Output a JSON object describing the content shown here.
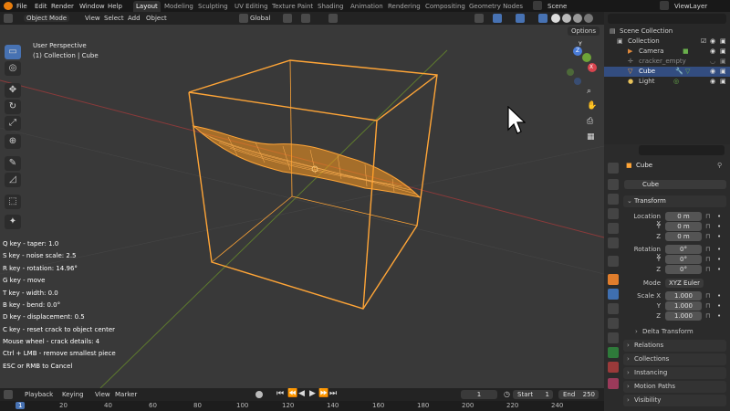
{
  "topbar": {
    "menus": [
      "File",
      "Edit",
      "Render",
      "Window",
      "Help"
    ],
    "workspaces": [
      "Layout",
      "Modeling",
      "Sculpting",
      "UV Editing",
      "Texture Paint",
      "Shading",
      "Animation",
      "Rendering",
      "Compositing",
      "Geometry Nodes"
    ],
    "active_workspace": "Layout",
    "scene_name": "Scene",
    "view_layer": "ViewLayer"
  },
  "viewport_header": {
    "mode": "Object Mode",
    "menus": [
      "View",
      "Select",
      "Add",
      "Object"
    ],
    "transform_orientation": "Global",
    "options_label": "Options"
  },
  "viewport": {
    "perspective_label": "User Perspective",
    "collection_label": "(1) Collection | Cube",
    "gizmo_axes": [
      "Y",
      "X",
      "Z"
    ],
    "accent_color": "#ffa537"
  },
  "hints": [
    "Q key - taper: 1.0",
    "S key - noise scale: 2.5",
    "R key - rotation: 14.96°",
    "G key - move",
    "T key - width: 0.0",
    "B key - bend: 0.0°",
    "D key - displacement: 0.5",
    "C key - reset crack to object center",
    "Mouse wheel - crack details: 4",
    "Ctrl + LMB - remove smallest piece",
    "ESC or RMB to Cancel"
  ],
  "outliner": {
    "title": "Scene Collection",
    "items": [
      {
        "label": "Collection",
        "icon": "collection-icon"
      },
      {
        "label": "Camera",
        "icon": "camera-icon"
      },
      {
        "label": "cracker_empty",
        "icon": "empty-icon"
      },
      {
        "label": "Cube",
        "icon": "mesh-icon"
      },
      {
        "label": "Light",
        "icon": "light-icon"
      }
    ],
    "selected": "Cube"
  },
  "properties": {
    "object_name": "Cube",
    "datablock_name": "Cube",
    "transform_label": "Transform",
    "location_label": "Location X",
    "location": [
      "0 m",
      "0 m",
      "0 m"
    ],
    "rotation_label": "Rotation X",
    "rotation": [
      "0°",
      "0°",
      "0°"
    ],
    "mode_label": "Mode",
    "mode_value": "XYZ Euler",
    "scale_label": "Scale X",
    "scale": [
      "1.000",
      "1.000",
      "1.000"
    ],
    "axis_y": "Y",
    "axis_z": "Z",
    "delta_transform": "Delta Transform",
    "panels": [
      "Relations",
      "Collections",
      "Instancing",
      "Motion Paths",
      "Visibility"
    ]
  },
  "timeline": {
    "menus": [
      "Playback",
      "Keying",
      "View",
      "Marker"
    ],
    "current_frame": "1",
    "start_label": "Start",
    "start": "1",
    "end_label": "End",
    "end": "250",
    "ruler_ticks": [
      "1",
      "20",
      "40",
      "60",
      "80",
      "100",
      "120",
      "140",
      "160",
      "180",
      "200",
      "220",
      "240"
    ]
  }
}
